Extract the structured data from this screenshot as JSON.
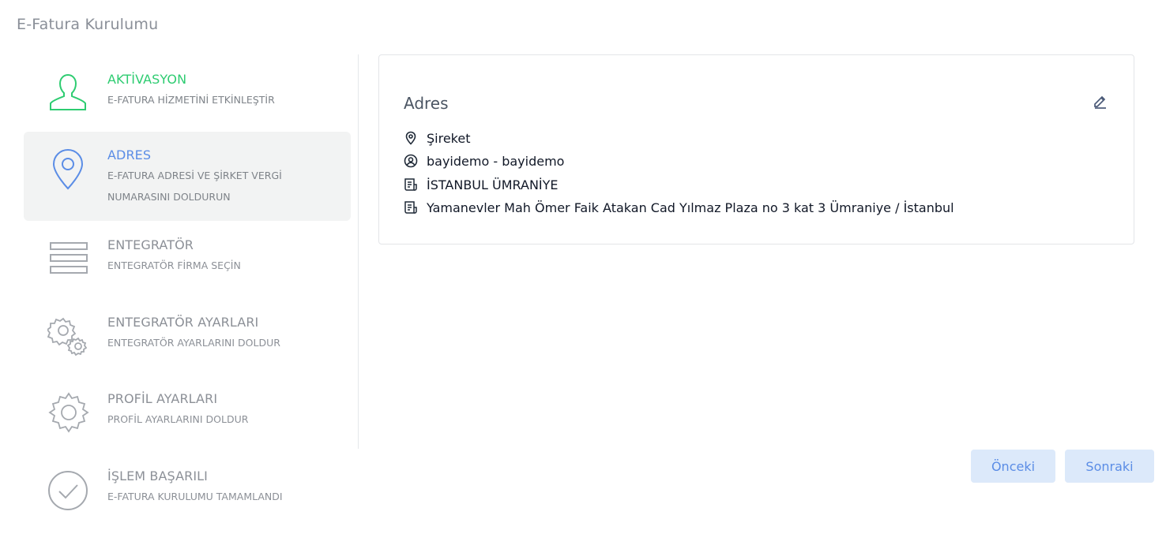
{
  "page": {
    "title": "E-Fatura Kurulumu"
  },
  "steps": [
    {
      "title": "AKTİVASYON",
      "desc": "E-FATURA HİZMETİNİ ETKİNLEŞTİR",
      "icon": "user-icon",
      "state": "done",
      "color": "#2ecc71"
    },
    {
      "title": "ADRES",
      "desc": "E-FATURA ADRESİ VE ŞİRKET VERGİ NUMARASINI DOLDURUN",
      "icon": "location-pin-icon",
      "state": "active",
      "color": "#5b8de6"
    },
    {
      "title": "ENTEGRATÖR",
      "desc": "ENTEGRATÖR FİRMA SEÇİN",
      "icon": "list-icon",
      "state": "pending"
    },
    {
      "title": "ENTEGRATÖR AYARLARI",
      "desc": "ENTEGRATÖR AYARLARINI DOLDUR",
      "icon": "gears-icon",
      "state": "pending"
    },
    {
      "title": "PROFİL AYARLARI",
      "desc": "PROFİL AYARLARINI DOLDUR",
      "icon": "gear-icon",
      "state": "pending"
    },
    {
      "title": "İŞLEM BAŞARILI",
      "desc": "E-FATURA KURULUMU TAMAMLANDI",
      "icon": "check-circle-icon",
      "state": "pending"
    }
  ],
  "card": {
    "title": "Adres",
    "lines": [
      {
        "icon": "location-pin-icon",
        "text": "Şireket"
      },
      {
        "icon": "user-circle-icon",
        "text": "bayidemo - bayidemo"
      },
      {
        "icon": "receipt-icon",
        "text": "İSTANBUL ÜMRANİYE"
      },
      {
        "icon": "receipt-icon",
        "text": "Yamanevler Mah Ömer Faik Atakan Cad Yılmaz Plaza no 3 kat 3 Ümraniye / İstanbul"
      }
    ]
  },
  "buttons": {
    "prev": "Önceki",
    "next": "Sonraki"
  }
}
